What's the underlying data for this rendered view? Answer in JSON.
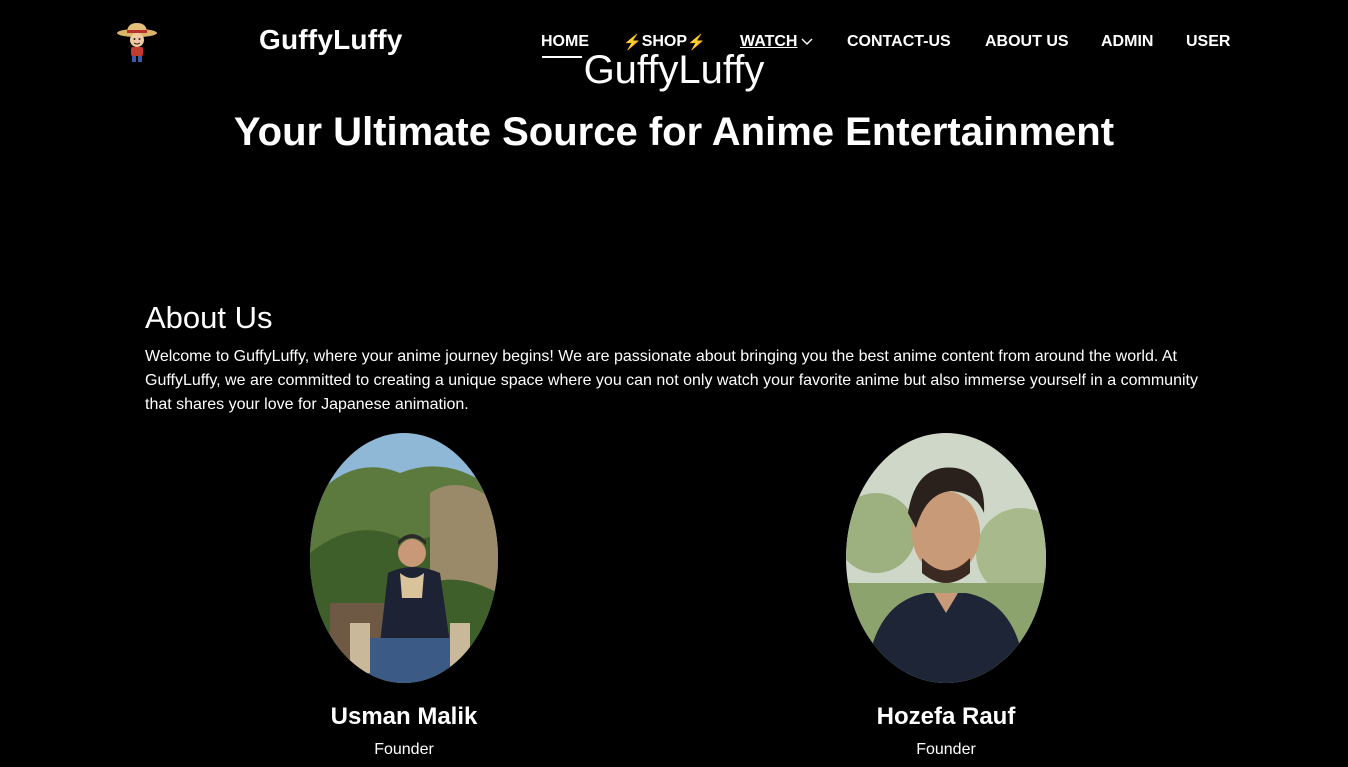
{
  "header": {
    "brand": "GuffyLuffy",
    "logo_icon": "straw-hat-character-icon",
    "nav": {
      "home": "HOME",
      "shop_bolt": "⚡",
      "shop": "SHOP",
      "watch": "WATCH",
      "contact": "CONTACT-US",
      "about": "ABOUT US",
      "admin": "ADMIN",
      "user": "USER"
    }
  },
  "hero": {
    "subtitle": "GuffyLuffy",
    "title": "Your Ultimate Source for Anime Entertainment"
  },
  "about": {
    "heading": "About Us",
    "text": "Welcome to GuffyLuffy, where your anime journey begins! We are passionate about bringing you the best anime content from around the world. At GuffyLuffy, we are committed to creating a unique space where you can not only watch your favorite anime but also immerse yourself in a community that shares your love for Japanese animation."
  },
  "team": [
    {
      "name": "Usman Malik",
      "role": "Founder"
    },
    {
      "name": "Hozefa Rauf",
      "role": "Founder"
    }
  ],
  "colors": {
    "background": "#000000",
    "text": "#ffffff",
    "bolt": "#f4c20d"
  }
}
